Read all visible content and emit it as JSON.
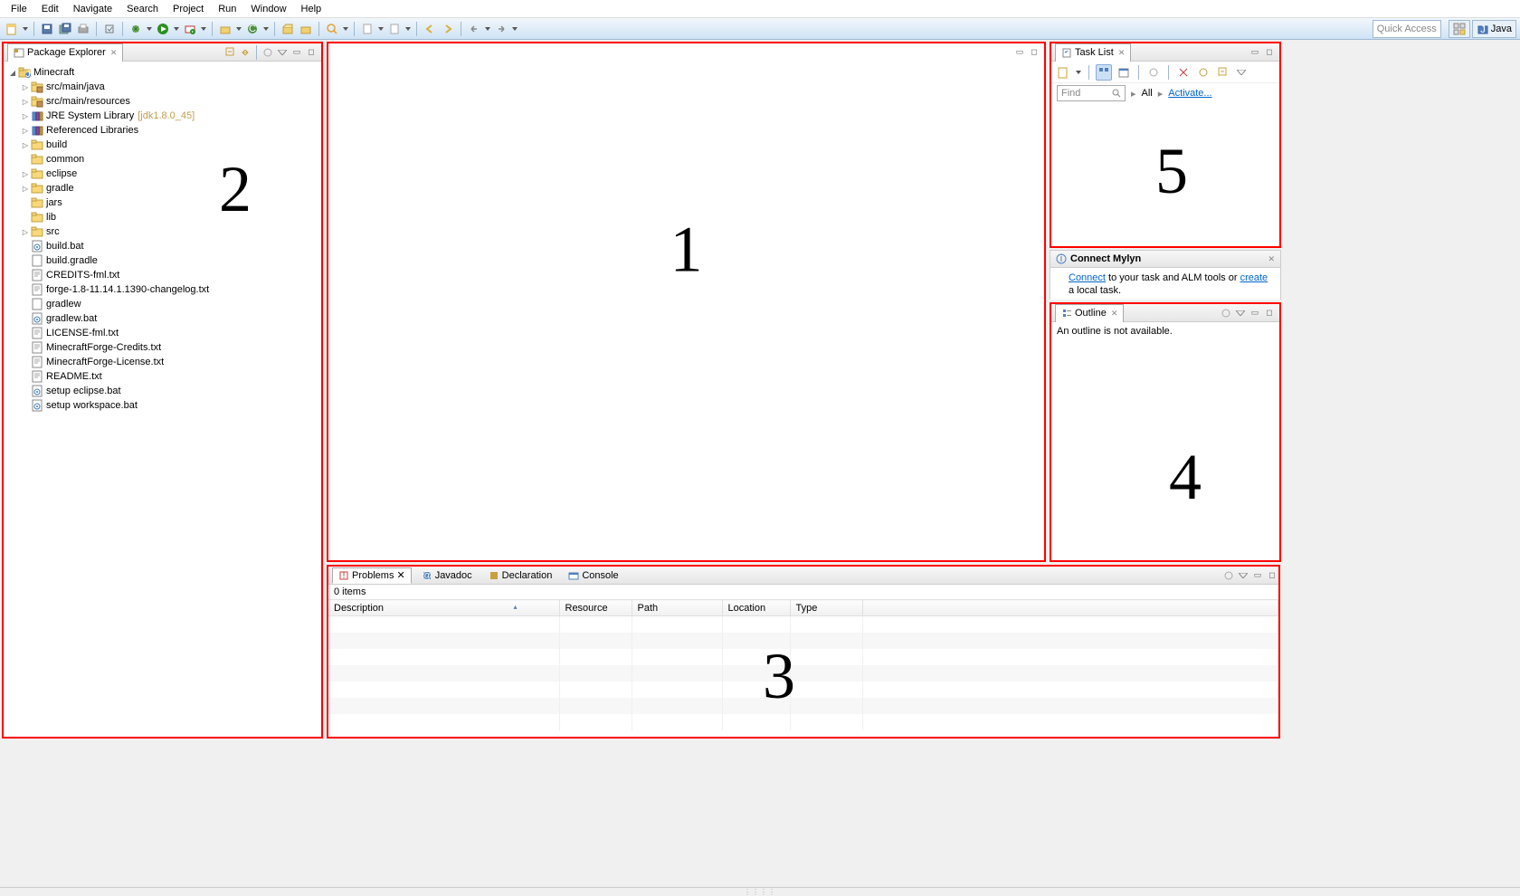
{
  "menu": [
    "File",
    "Edit",
    "Navigate",
    "Search",
    "Project",
    "Run",
    "Window",
    "Help"
  ],
  "quick_access": "Quick Access",
  "perspective": {
    "label": "Java"
  },
  "package_explorer": {
    "title": "Package Explorer",
    "project": "Minecraft",
    "nodes": [
      {
        "kind": "pkg-folder",
        "label": "src/main/java",
        "exp": true
      },
      {
        "kind": "pkg-folder",
        "label": "src/main/resources",
        "exp": true
      },
      {
        "kind": "lib",
        "label": "JRE System Library",
        "annot": "[jdk1.8.0_45]",
        "exp": true
      },
      {
        "kind": "lib",
        "label": "Referenced Libraries",
        "exp": true
      },
      {
        "kind": "folder",
        "label": "build",
        "exp": true
      },
      {
        "kind": "folder",
        "label": "common"
      },
      {
        "kind": "folder",
        "label": "eclipse",
        "exp": true
      },
      {
        "kind": "folder",
        "label": "gradle",
        "exp": true
      },
      {
        "kind": "folder",
        "label": "jars"
      },
      {
        "kind": "folder",
        "label": "lib"
      },
      {
        "kind": "folder",
        "label": "src",
        "exp": true
      },
      {
        "kind": "bat",
        "label": "build.bat"
      },
      {
        "kind": "file",
        "label": "build.gradle"
      },
      {
        "kind": "txt",
        "label": "CREDITS-fml.txt"
      },
      {
        "kind": "txt",
        "label": "forge-1.8-11.14.1.1390-changelog.txt"
      },
      {
        "kind": "file",
        "label": "gradlew"
      },
      {
        "kind": "bat",
        "label": "gradlew.bat"
      },
      {
        "kind": "txt",
        "label": "LICENSE-fml.txt"
      },
      {
        "kind": "txt",
        "label": "MinecraftForge-Credits.txt"
      },
      {
        "kind": "txt",
        "label": "MinecraftForge-License.txt"
      },
      {
        "kind": "txt",
        "label": "README.txt"
      },
      {
        "kind": "bat",
        "label": "setup eclipse.bat"
      },
      {
        "kind": "bat",
        "label": "setup workspace.bat"
      }
    ]
  },
  "problems": {
    "tabs": [
      "Problems",
      "Javadoc",
      "Declaration",
      "Console"
    ],
    "status": "0 items",
    "columns": [
      "Description",
      "Resource",
      "Path",
      "Location",
      "Type"
    ]
  },
  "tasklist": {
    "title": "Task List",
    "find": "Find",
    "all": "All",
    "activate": "Activate..."
  },
  "mylyn": {
    "title": "Connect Mylyn",
    "link1": "Connect",
    "text1": " to your task and ALM tools or ",
    "link2": "create",
    "text2": " a local task."
  },
  "outline": {
    "title": "Outline",
    "empty": "An outline is not available."
  },
  "nums": {
    "editor": "1",
    "explorer": "2",
    "problems": "3",
    "outline": "4",
    "tasks": "5"
  }
}
